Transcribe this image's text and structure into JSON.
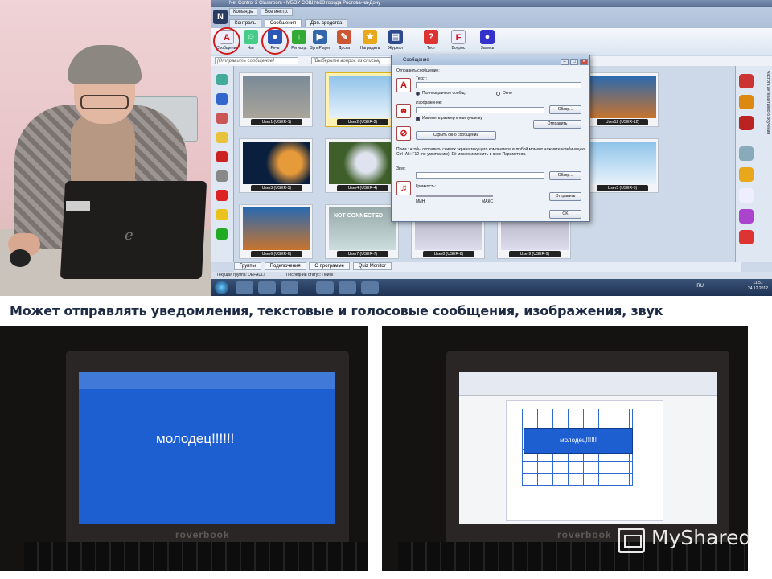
{
  "caption": "Может отправлять уведомления, текстовые и голосовые сообщения, изображения, звук",
  "app": {
    "window_title": "Net Control 2 Classroom - МБОУ СОШ №83 города Ростова-на-Дону",
    "menu": [
      "Команды",
      "Все инстр."
    ],
    "tabs": [
      "Контроль",
      "Сообщения",
      "Доп. средства"
    ],
    "active_tab": "Сообщения",
    "ribbon_buttons": [
      "Сообщения",
      "Чат",
      "Речь",
      "Регистр.",
      "SyncPlayer",
      "Доска",
      "Наградить",
      "Журнал",
      "Тест",
      "Вопрос",
      "Запись"
    ],
    "ribbon_groups": [
      "Сообщения"
    ],
    "message_placeholder": "[Отправить сообщение]",
    "question_placeholder": "[Выберите вопрос из списка]",
    "thumbnails": [
      {
        "label": "User1 (USER-1)",
        "state": "screen"
      },
      {
        "label": "User2 (USER-2)",
        "state": "screen",
        "selected": true
      },
      {
        "label": "User12 (USER-12)",
        "state": "screen"
      },
      {
        "label": "User3 (USER-3)",
        "state": "screen"
      },
      {
        "label": "User4 (USER-4)",
        "state": "screen"
      },
      {
        "label": "User5 (USER-5)",
        "state": "screen"
      },
      {
        "label": "User6 (USER-6)",
        "state": "screen"
      },
      {
        "label": "User7 (USER-7)",
        "state": "not-connected",
        "overlay": "NOT CONNECTED"
      },
      {
        "label": "User8 (USER-8)",
        "state": "off"
      },
      {
        "label": "User9 (USER-9)",
        "state": "off"
      }
    ],
    "bottom_tabs": [
      "Группы",
      "Подключения",
      "О программе",
      "Quiz Monitor"
    ],
    "status": {
      "group": "Текущая группа: DEFAULT",
      "last_status": "Последний статус: Поиск"
    },
    "right_panel_text": "Частота интерактивного обучения",
    "taskbar": {
      "lang": "RU",
      "time": "11:51",
      "date": "24.12.2012"
    }
  },
  "dialog": {
    "title": "Сообщение",
    "send_message_label": "Отправить сообщение:",
    "text_label": "Текст:",
    "fullscreen_option": "Полноэкранное сообщ.",
    "window_option": "Окно",
    "image_label": "Изображение:",
    "browse": "Обзор...",
    "resize_label": "Изменять размер к наилучшему",
    "send": "Отправить",
    "hide_messages": "Скрыть окно сообщений",
    "note": "Прим.: чтобы отправить снимок экрана текущего компьютера в любой момент нажмите комбинацию Ctrl+Alt+F12 (по умолчанию). Её можно изменить в окне Параметров.",
    "sound_label": "Звук:",
    "browse2": "Обзор...",
    "volume_label": "Громкость:",
    "min": "МИН",
    "max": "МАКС",
    "send2": "Отправить",
    "ok": "OK"
  },
  "photo_left": {
    "laptop_brand": "roverbook",
    "message": "молодец!!!!!!"
  },
  "photo_right": {
    "laptop_brand": "roverbook",
    "message": "молодец!!!!!!"
  },
  "watermark": "MyShared",
  "colors": {
    "caption_text": "#1d2b44",
    "message_screen": "#1d5fd1",
    "selection_circle": "#d21c1c",
    "selected_thumb": "#fff1b2"
  }
}
